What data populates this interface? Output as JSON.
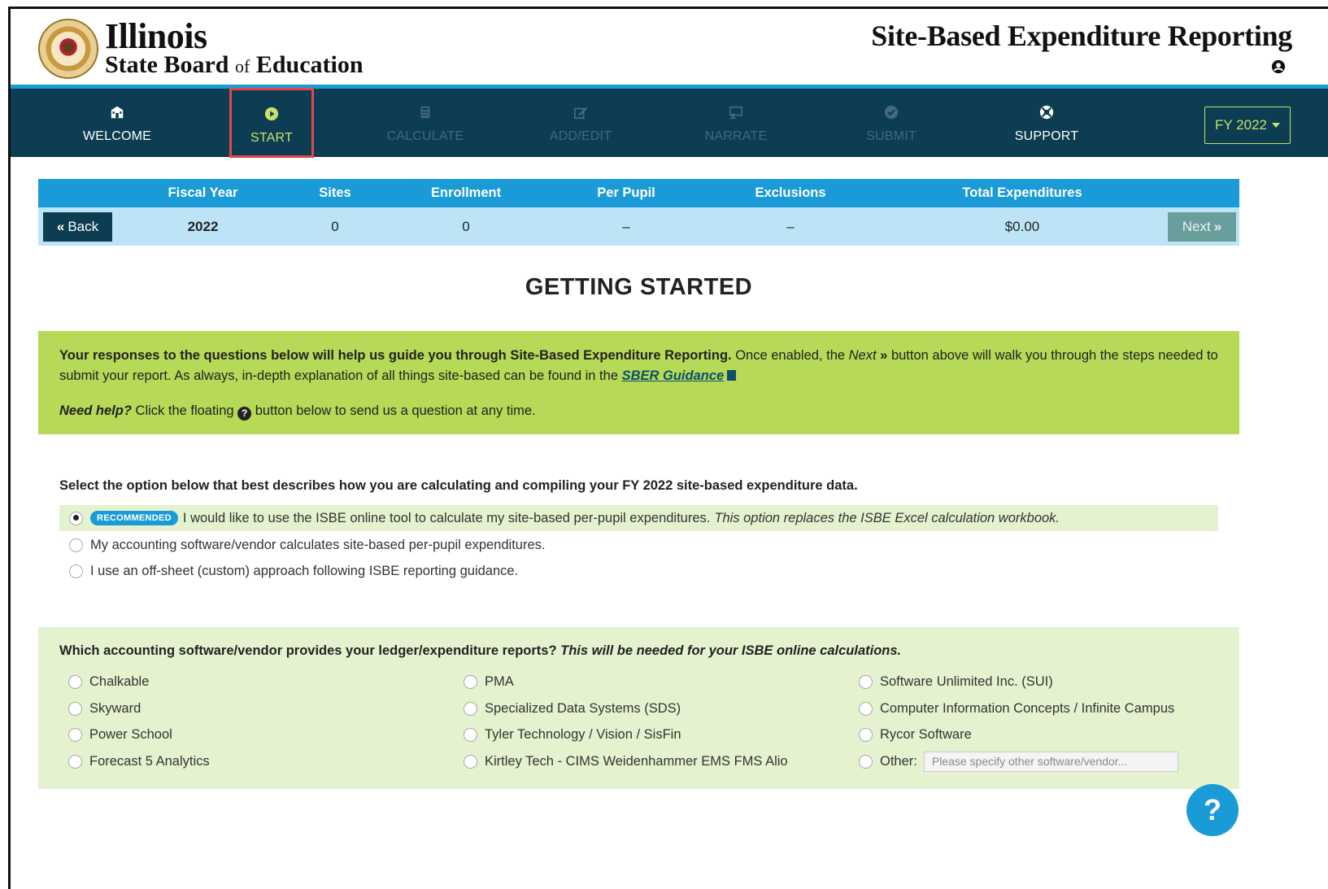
{
  "header": {
    "brand_line1": "Illinois",
    "brand_line2_a": "State Board",
    "brand_line2_of": "of",
    "brand_line2_b": "Education",
    "app_title": "Site-Based Expenditure Reporting",
    "user_icon": "user-circle-icon"
  },
  "nav": {
    "items": [
      {
        "label": "WELCOME",
        "icon": "school-building-icon",
        "state": "normal"
      },
      {
        "label": "START",
        "icon": "play-circle-icon",
        "state": "active"
      },
      {
        "label": "CALCULATE",
        "icon": "calculator-icon",
        "state": "disabled"
      },
      {
        "label": "ADD/EDIT",
        "icon": "edit-icon",
        "state": "disabled"
      },
      {
        "label": "NARRATE",
        "icon": "presentation-icon",
        "state": "disabled"
      },
      {
        "label": "SUBMIT",
        "icon": "check-circle-icon",
        "state": "disabled"
      },
      {
        "label": "SUPPORT",
        "icon": "lifebuoy-icon",
        "state": "normal"
      }
    ],
    "fy_label": "FY 2022"
  },
  "summary": {
    "headers": [
      "Fiscal Year",
      "Sites",
      "Enrollment",
      "Per Pupil",
      "Exclusions",
      "Total Expenditures"
    ],
    "values": [
      "2022",
      "0",
      "0",
      "–",
      "–",
      "$0.00"
    ],
    "back_label": "Back",
    "next_label": "Next"
  },
  "page_title": "GETTING STARTED",
  "intro": {
    "bold_lead": "Your responses to the questions below will help us guide you through Site-Based Expenditure Reporting.",
    "text_a": " Once enabled, the ",
    "next_word": "Next",
    "next_chevrons": "»",
    "text_b": " button above will walk you through the steps needed to submit your report. As always, in-depth explanation of all things site-based can be found in the ",
    "guidance_link": "SBER Guidance",
    "need_help": "Need help?",
    "help_text_a": " Click the floating ",
    "help_text_b": " button below to send us a question at any time."
  },
  "question1": {
    "label": "Select the option below that best describes how you are calculating and compiling your FY 2022 site-based expenditure data.",
    "badge": "RECOMMENDED",
    "options": [
      {
        "text": "I would like to use the ISBE online tool to calculate my site-based per-pupil expenditures.",
        "italic": "This option replaces the ISBE Excel calculation workbook.",
        "selected": true
      },
      {
        "text": "My accounting software/vendor calculates site-based per-pupil expenditures.",
        "selected": false
      },
      {
        "text": "I use an off-sheet (custom) approach following ISBE reporting guidance.",
        "selected": false
      }
    ]
  },
  "question2": {
    "label": "Which accounting software/vendor provides your ledger/expenditure reports?",
    "label_italic": "This will be needed for your ISBE online calculations.",
    "col1": [
      "Chalkable",
      "Skyward",
      "Power School",
      "Forecast 5 Analytics"
    ],
    "col2": [
      "PMA",
      "Specialized Data Systems (SDS)",
      "Tyler Technology / Vision / SisFin",
      "Kirtley Tech - CIMS Weidenhammer EMS FMS Alio"
    ],
    "col3": [
      "Software Unlimited Inc. (SUI)",
      "Computer Information Concepts / Infinite Campus",
      "Rycor Software"
    ],
    "other_label": "Other:",
    "other_placeholder": "Please specify other software/vendor..."
  },
  "help_fab": "?",
  "colors": {
    "nav_bg": "#0c3d52",
    "accent_blue": "#1a9bd7",
    "active_green": "#c9e16a",
    "intro_green": "#b6d957",
    "light_green": "#e5f2cf",
    "summary_row": "#bde4f6",
    "highlight_red": "#e04848"
  }
}
